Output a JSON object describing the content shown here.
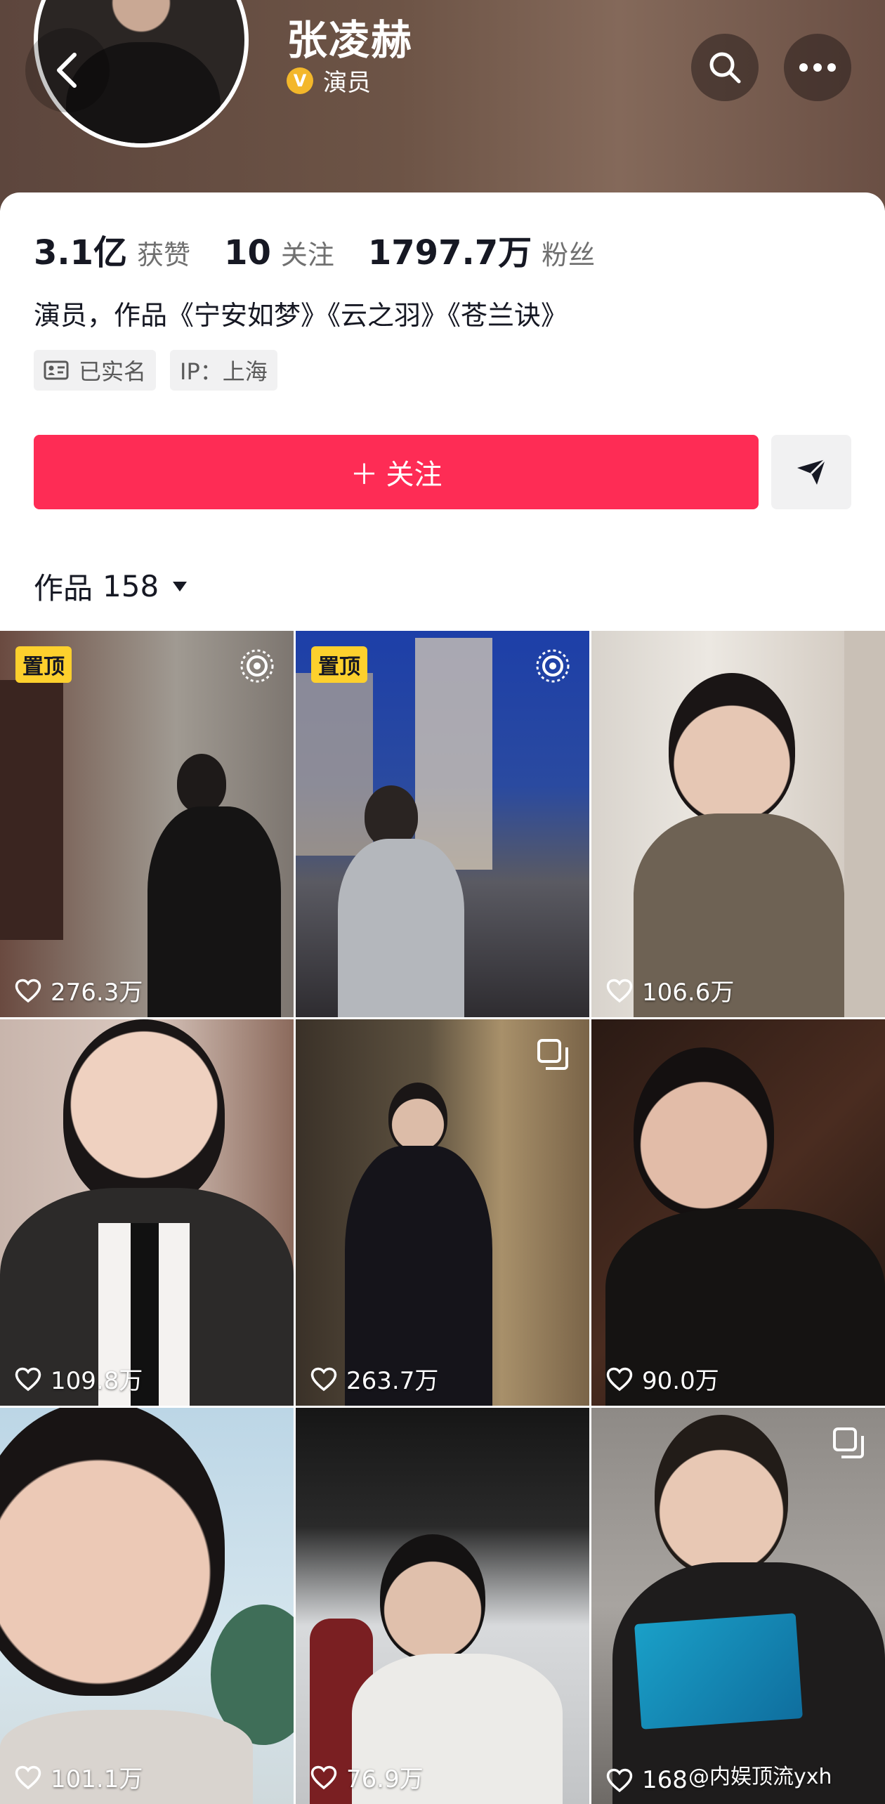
{
  "profile": {
    "name": "张凌赫",
    "role": "演员",
    "verified_badge": "V",
    "bio": "演员，作品《宁安如梦》《云之羽》《苍兰诀》",
    "tags": [
      {
        "icon": "id-card-icon",
        "label": "已实名"
      },
      {
        "icon": "",
        "label": "IP：上海"
      }
    ]
  },
  "stats": [
    {
      "value": "3.1亿",
      "label": "获赞"
    },
    {
      "value": "10",
      "label": "关注"
    },
    {
      "value": "1797.7万",
      "label": "粉丝"
    }
  ],
  "actions": {
    "follow_label": "＋ 关注",
    "share_icon": "send-icon"
  },
  "works": {
    "label": "作品",
    "count": "158"
  },
  "colors": {
    "accent": "#fe2c55",
    "pin_bg": "#fdd02d",
    "verified": "#f3b72a"
  },
  "grid": [
    {
      "likes": "276.3万",
      "pinned": "置顶",
      "badge": "live-icon"
    },
    {
      "likes": "",
      "pinned": "置顶",
      "badge": "live-icon"
    },
    {
      "likes": "106.6万",
      "pinned": "",
      "badge": ""
    },
    {
      "likes": "109.8万",
      "pinned": "",
      "badge": ""
    },
    {
      "likes": "263.7万",
      "pinned": "",
      "badge": "multi-image-icon"
    },
    {
      "likes": "90.0万",
      "pinned": "",
      "badge": ""
    },
    {
      "likes": "101.1万",
      "pinned": "",
      "badge": ""
    },
    {
      "likes": "76.9万",
      "pinned": "",
      "badge": ""
    },
    {
      "likes": "168",
      "pinned": "",
      "badge": "multi-image-icon"
    }
  ],
  "watermark": "@内娱顶流yxh"
}
